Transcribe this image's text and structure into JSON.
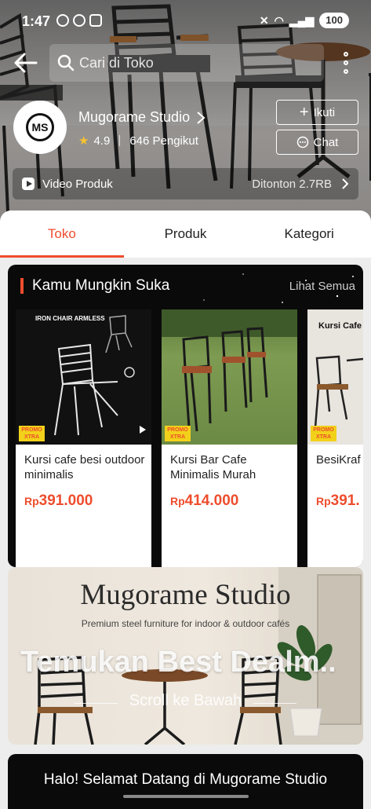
{
  "status_bar": {
    "time": "1:47",
    "battery": "100"
  },
  "header": {
    "search_placeholder": "Cari di Toko",
    "shop": {
      "name": "Mugorame Studio",
      "logo_text": "MS",
      "rating": "4.9",
      "followers": "646 Pengikut",
      "follow_label": "Ikuti",
      "chat_label": "Chat"
    },
    "video": {
      "label": "Video Produk",
      "views": "Ditonton 2.7RB"
    }
  },
  "tabs": [
    {
      "label": "Toko",
      "active": true
    },
    {
      "label": "Produk",
      "active": false
    },
    {
      "label": "Kategori",
      "active": false
    }
  ],
  "suggestions": {
    "title": "Kamu Mungkin Suka",
    "see_all": "Lihat Semua",
    "items": [
      {
        "name": "Kursi cafe besi outdoor minimalis",
        "currency": "Rp",
        "price": "391.000",
        "image_caption": "IRON CHAIR ARMLESS",
        "promo_line1": "PROMO",
        "promo_line2": "XTRA"
      },
      {
        "name": "Kursi Bar Cafe Minimalis Murah",
        "currency": "Rp",
        "price": "414.000",
        "promo_line1": "PROMO",
        "promo_line2": "XTRA"
      },
      {
        "name": "BesiKraf Cafe Bes",
        "currency": "Rp",
        "price": "391.",
        "image_caption": "Kursi Cafe Outdoor",
        "promo_line1": "PROMO",
        "promo_line2": "XTRA"
      }
    ]
  },
  "banner": {
    "title": "Mugorame Studio",
    "subtitle": "Premium steel furniture for indoor & outdoor cafés",
    "cta": "Temukan Best Dealm..",
    "scroll_hint": "Scroll ke Bawah"
  },
  "welcome": {
    "text": "Halo! Selamat Datang di Mugorame Studio"
  },
  "colors": {
    "accent": "#ee4d2d",
    "rating_star": "#f7c32e",
    "promo_badge": "#f2d11a"
  }
}
